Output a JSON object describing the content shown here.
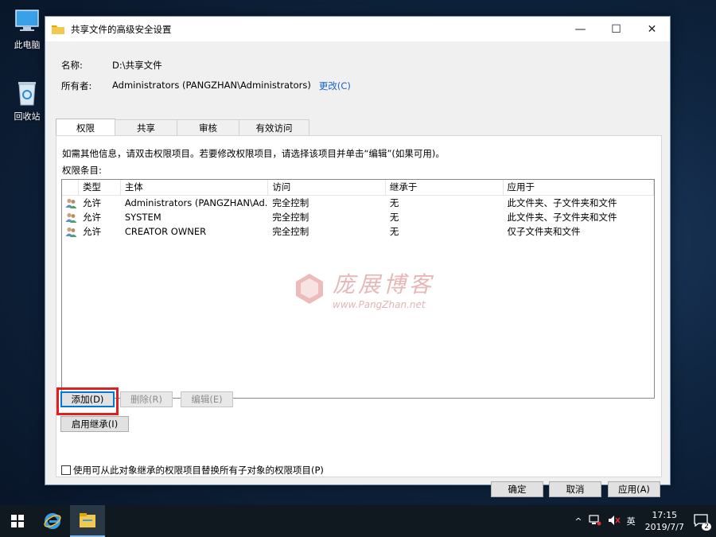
{
  "desktop": {
    "icons": [
      {
        "label": "此电脑"
      },
      {
        "label": "回收站"
      }
    ]
  },
  "window": {
    "title": "共享文件的高级安全设置",
    "controls": {
      "minimize": "—",
      "maximize": "☐",
      "close": "✕"
    },
    "name_key": "名称:",
    "name_value": "D:\\共享文件",
    "owner_key": "所有者:",
    "owner_value": "Administrators (PANGZHAN\\Administrators)",
    "owner_change": "更改(C)",
    "tabs": [
      {
        "label": "权限"
      },
      {
        "label": "共享"
      },
      {
        "label": "审核"
      },
      {
        "label": "有效访问"
      }
    ],
    "description": "如需其他信息，请双击权限项目。若要修改权限项目，请选择该项目并单击“编辑”(如果可用)。",
    "entries_label": "权限条目:",
    "columns": [
      "类型",
      "主体",
      "访问",
      "继承于",
      "应用于"
    ],
    "rows": [
      {
        "type": "允许",
        "principal": "Administrators (PANGZHAN\\Ad...",
        "access": "完全控制",
        "inherited": "无",
        "applies": "此文件夹、子文件夹和文件"
      },
      {
        "type": "允许",
        "principal": "SYSTEM",
        "access": "完全控制",
        "inherited": "无",
        "applies": "此文件夹、子文件夹和文件"
      },
      {
        "type": "允许",
        "principal": "CREATOR OWNER",
        "access": "完全控制",
        "inherited": "无",
        "applies": "仅子文件夹和文件"
      }
    ],
    "watermark": {
      "big": "庞展博客",
      "small": "www.PangZhan.net"
    },
    "buttons": {
      "add": "添加(D)",
      "remove": "删除(R)",
      "edit": "编辑(E)",
      "enable_inheritance": "启用继承(I)",
      "ok": "确定",
      "cancel": "取消",
      "apply": "应用(A)"
    },
    "replace_checkbox": "使用可从此对象继承的权限项目替换所有子对象的权限项目(P)"
  },
  "taskbar": {
    "time": "17:15",
    "date": "2019/7/7",
    "ime": "英",
    "notifications": "2",
    "tray_up": "^"
  },
  "colors": {
    "link": "#1a64c8",
    "highlight": "#e02020",
    "taskbar": "#101820"
  }
}
